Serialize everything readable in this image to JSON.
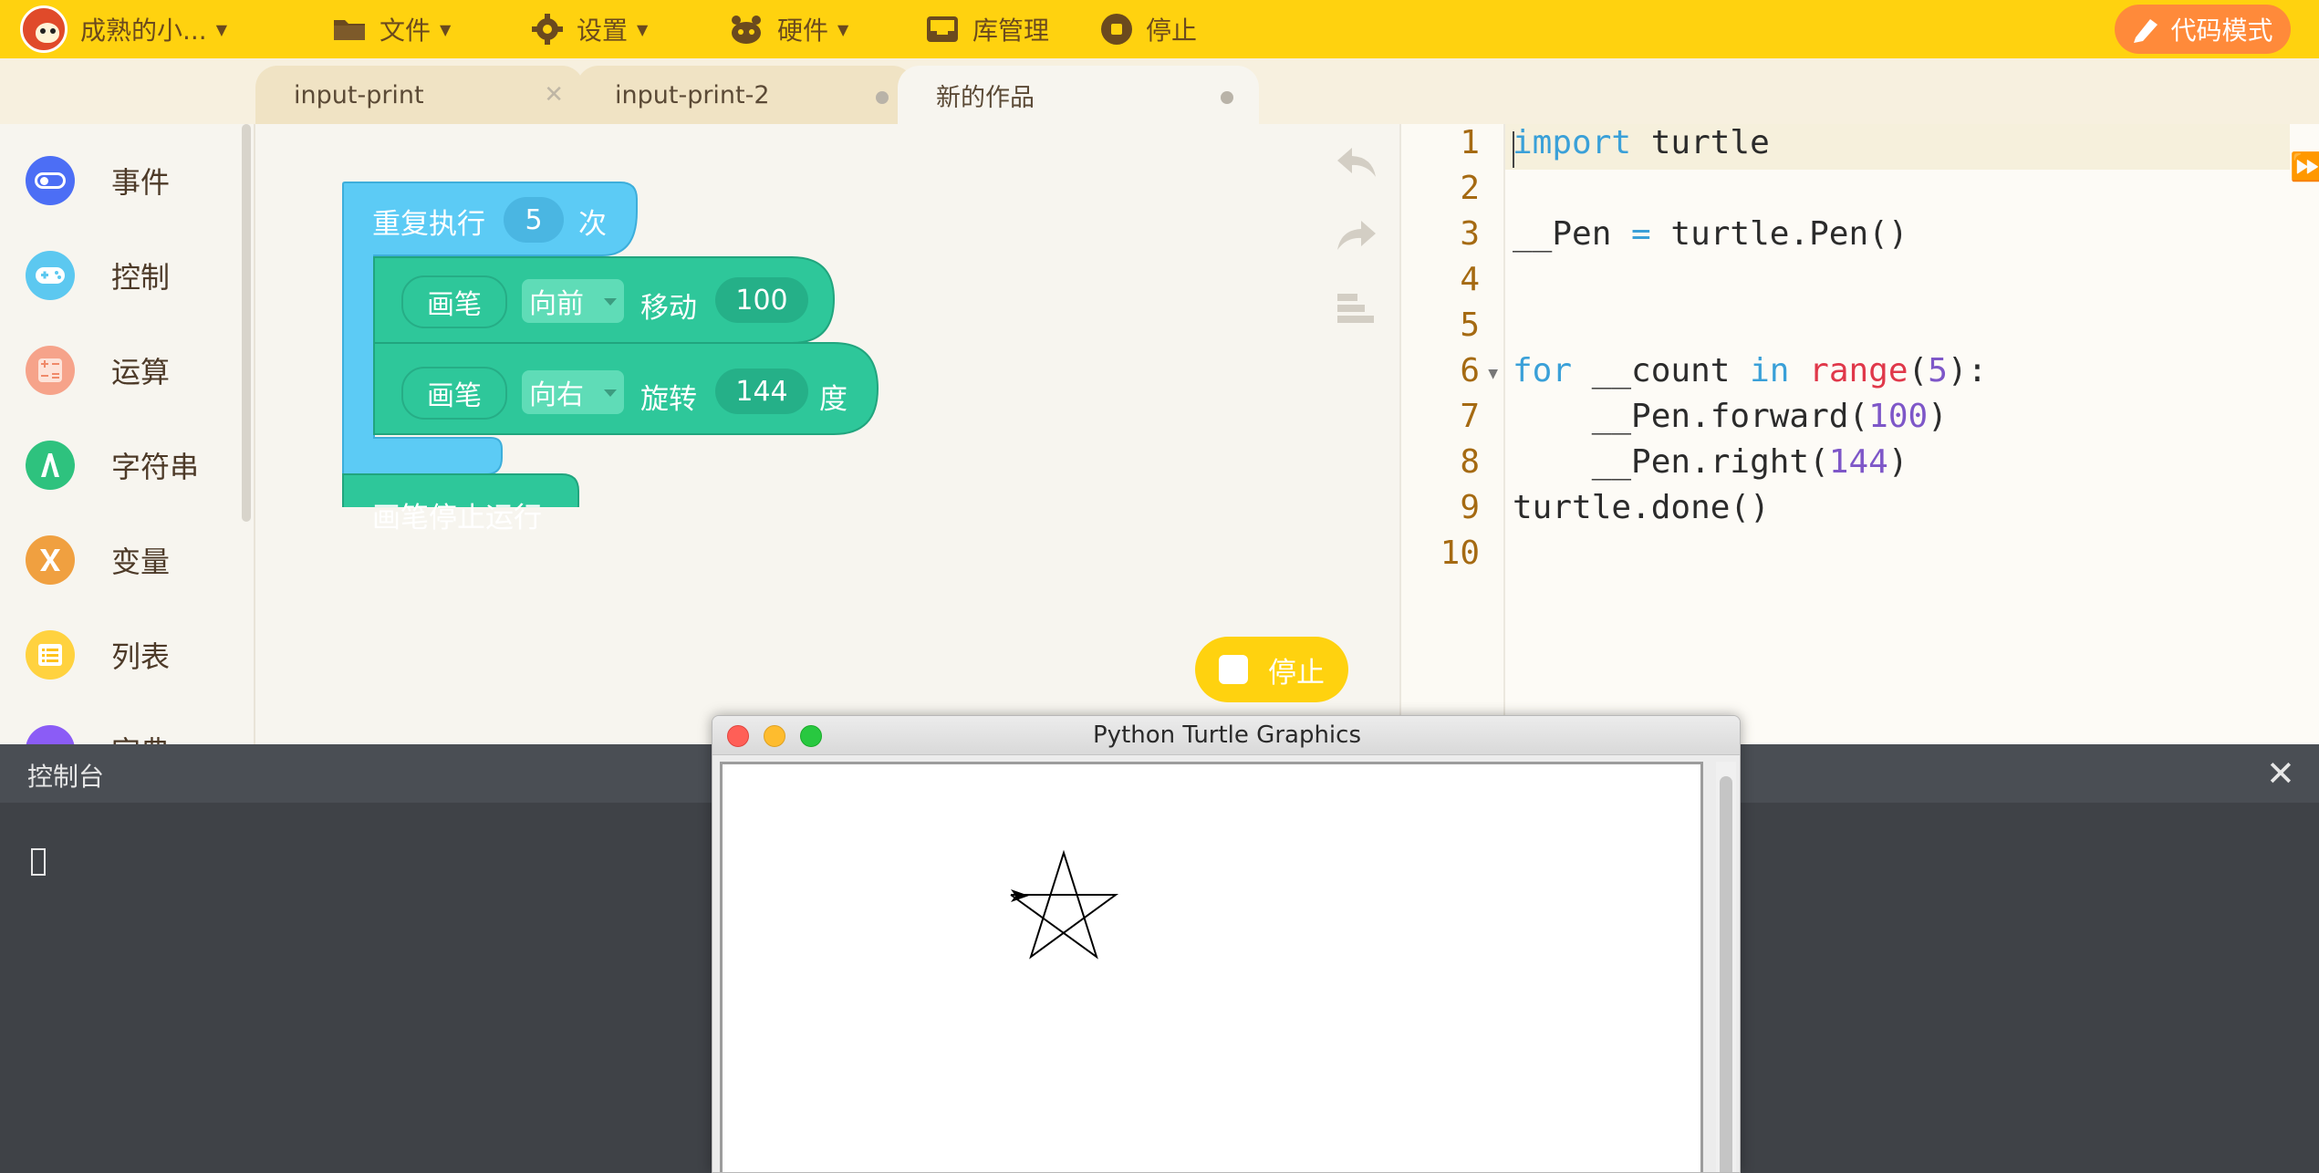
{
  "topbar": {
    "project_name": "成熟的小...",
    "menu_file": "文件",
    "menu_settings": "设置",
    "menu_hardware": "硬件",
    "menu_library": "库管理",
    "menu_stop": "停止",
    "code_mode_label": "代码模式"
  },
  "tabs": [
    {
      "label": "input-print",
      "state": "closable"
    },
    {
      "label": "input-print-2",
      "state": "unsaved"
    },
    {
      "label": "新的作品",
      "state": "active"
    }
  ],
  "categories": [
    {
      "label": "事件",
      "icon": "toggle-icon",
      "color": "#4c6ef5"
    },
    {
      "label": "控制",
      "icon": "gamepad-icon",
      "color": "#5cc8f0"
    },
    {
      "label": "运算",
      "icon": "calculator-icon",
      "color": "#f6a38a"
    },
    {
      "label": "字符串",
      "icon": "string-a-icon",
      "color": "#2ec27e"
    },
    {
      "label": "变量",
      "icon": "variable-x-icon",
      "color": "#f0a040"
    },
    {
      "label": "列表",
      "icon": "list-icon",
      "color": "#ffd23f"
    },
    {
      "label": "字典",
      "icon": "dictionary-icon",
      "color": "#8b5cf6"
    }
  ],
  "blocks": {
    "repeat_label": "重复执行",
    "repeat_count": "5",
    "repeat_suffix": "次",
    "pen1_label": "画笔",
    "pen1_dir": "向前",
    "pen1_action": "移动",
    "pen1_value": "100",
    "pen2_label": "画笔",
    "pen2_dir": "向右",
    "pen2_action": "旋转",
    "pen2_value": "144",
    "pen2_unit": "度",
    "pen_stop": "画笔停止运行",
    "repeat_color": "#5ccbf5",
    "pen_color": "#2ec79a"
  },
  "run_button": "停止",
  "editor": {
    "line_numbers": [
      "1",
      "2",
      "3",
      "4",
      "5",
      "6",
      "7",
      "8",
      "9",
      "10"
    ]
  },
  "console": {
    "title": "控制台"
  },
  "turtle_window": {
    "title": "Python Turtle Graphics"
  }
}
